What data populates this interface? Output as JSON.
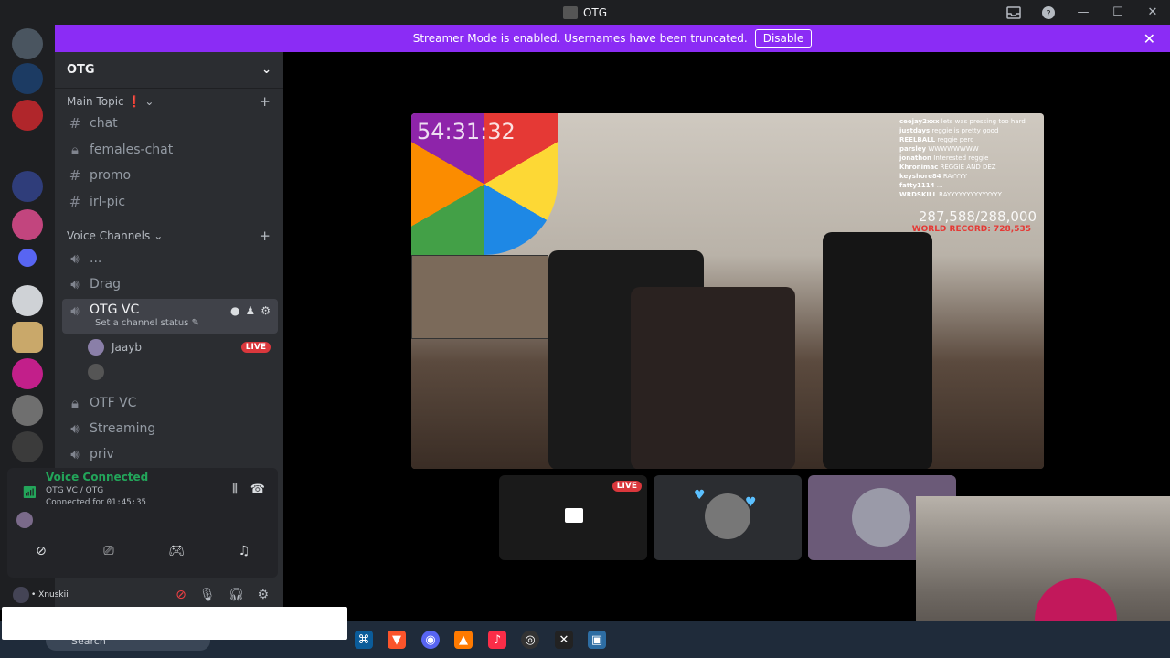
{
  "window": {
    "title": "OTG"
  },
  "banner": {
    "message": "Streamer Mode is enabled. Usernames have been truncated.",
    "disable_label": "Disable",
    "color": "#8b2cf5"
  },
  "server": {
    "name": "OTG"
  },
  "categories": {
    "main": "Main Topic ❗",
    "voice": "Voice Channels"
  },
  "text_channels": [
    "chat",
    "females-chat",
    "promo",
    "irl-pic"
  ],
  "voice_channels": {
    "v1": "...",
    "v2": "Drag",
    "active": "OTG VC",
    "active_status": "Set a channel status",
    "user1": "Jaayb",
    "live_label": "LIVE",
    "v4": "OTF VC",
    "v5": "Streaming",
    "v6": "priv"
  },
  "voice_panel": {
    "title": "Voice Connected",
    "channel": "OTG VC / OTG",
    "connected_label": "Connected for",
    "time": "01:45:35"
  },
  "user_panel": {
    "username": "• Xnuskii"
  },
  "stream": {
    "timer": "54:31:32",
    "counter": "287,588/288,000",
    "record": "WORLD RECORD: 728,535",
    "chat": [
      {
        "user": "ceejay2xxx",
        "msg": "lets was pressing too hard"
      },
      {
        "user": "justdays",
        "msg": "reggie is pretty good"
      },
      {
        "user": "REELBALL",
        "msg": "reggie perc"
      },
      {
        "user": "parsley",
        "msg": "WWWWWWWW"
      },
      {
        "user": "jonathon",
        "msg": "Interested reggie"
      },
      {
        "user": "Khronimac",
        "msg": "REGGIE AND DEZ"
      },
      {
        "user": "keyshore84",
        "msg": "RAYYYY"
      },
      {
        "user": "fatty1114",
        "msg": "..."
      },
      {
        "user": "WRDSKILL",
        "msg": "RAYYYYYYYYYYYYYY"
      }
    ]
  },
  "tiles": {
    "live_label": "LIVE"
  },
  "taskbar": {
    "search_placeholder": "Search"
  }
}
